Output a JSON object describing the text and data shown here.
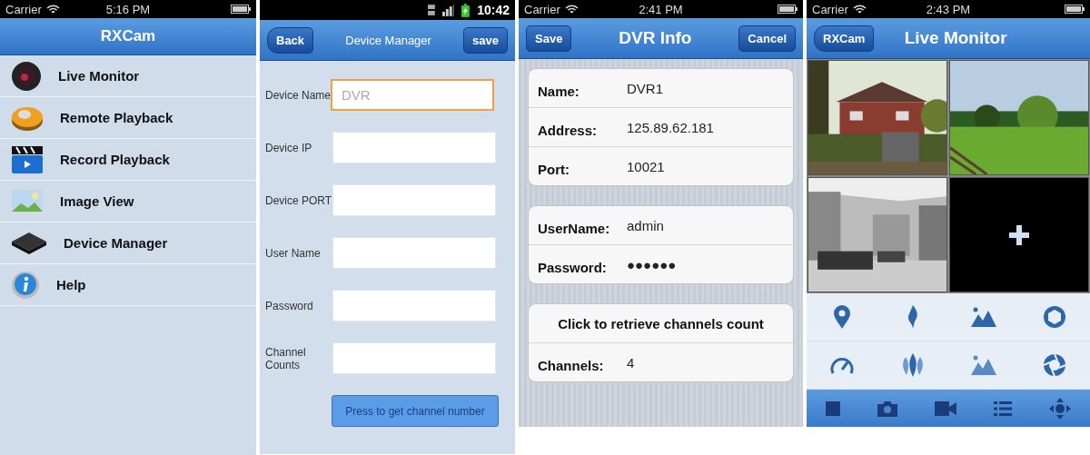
{
  "main_menu": {
    "status_bar": {
      "carrier": "Carrier",
      "time": "5:16 PM"
    },
    "title": "RXCam",
    "items": [
      {
        "label": "Live Monitor"
      },
      {
        "label": "Remote Playback"
      },
      {
        "label": "Record Playback"
      },
      {
        "label": "Image View"
      },
      {
        "label": "Device Manager"
      },
      {
        "label": "Help"
      }
    ]
  },
  "device_manager": {
    "status_bar": {
      "time": "10:42"
    },
    "back": "Back",
    "title": "Device Manager",
    "save": "save",
    "fields": [
      {
        "label": "Device Name",
        "placeholder": "DVR",
        "focused": true
      },
      {
        "label": "Device IP",
        "focused": false
      },
      {
        "label": "Device PORT",
        "focused": false
      },
      {
        "label": "User Name",
        "focused": false
      },
      {
        "label": "Password",
        "focused": false
      },
      {
        "label": "Channel Counts",
        "focused": false
      }
    ],
    "button": "Press to get channel number"
  },
  "dvr_info": {
    "status_bar": {
      "carrier": "Carrier",
      "time": "2:41 PM"
    },
    "save": "Save",
    "title": "DVR Info",
    "cancel": "Cancel",
    "groups": [
      {
        "rows": [
          {
            "kind": "field",
            "label": "Name:",
            "value": "DVR1"
          },
          {
            "kind": "field",
            "label": "Address:",
            "value": "125.89.62.181"
          },
          {
            "kind": "field",
            "label": "Port:",
            "value": "10021"
          }
        ]
      },
      {
        "rows": [
          {
            "kind": "field",
            "label": "UserName:",
            "value": "admin"
          },
          {
            "kind": "field",
            "label": "Password:",
            "value": "●●●●●●"
          }
        ]
      },
      {
        "rows": [
          {
            "kind": "action",
            "label": "Click to retrieve channels count"
          },
          {
            "kind": "field",
            "label": "Channels:",
            "value": "4"
          }
        ]
      }
    ]
  },
  "live_monitor": {
    "status_bar": {
      "carrier": "Carrier",
      "time": "2:43 PM"
    },
    "back": "RXCam",
    "title": "Live Monitor",
    "tiles": [
      {
        "kind": "picture"
      },
      {
        "kind": "picture"
      },
      {
        "kind": "picture"
      },
      {
        "kind": "add"
      }
    ]
  }
}
